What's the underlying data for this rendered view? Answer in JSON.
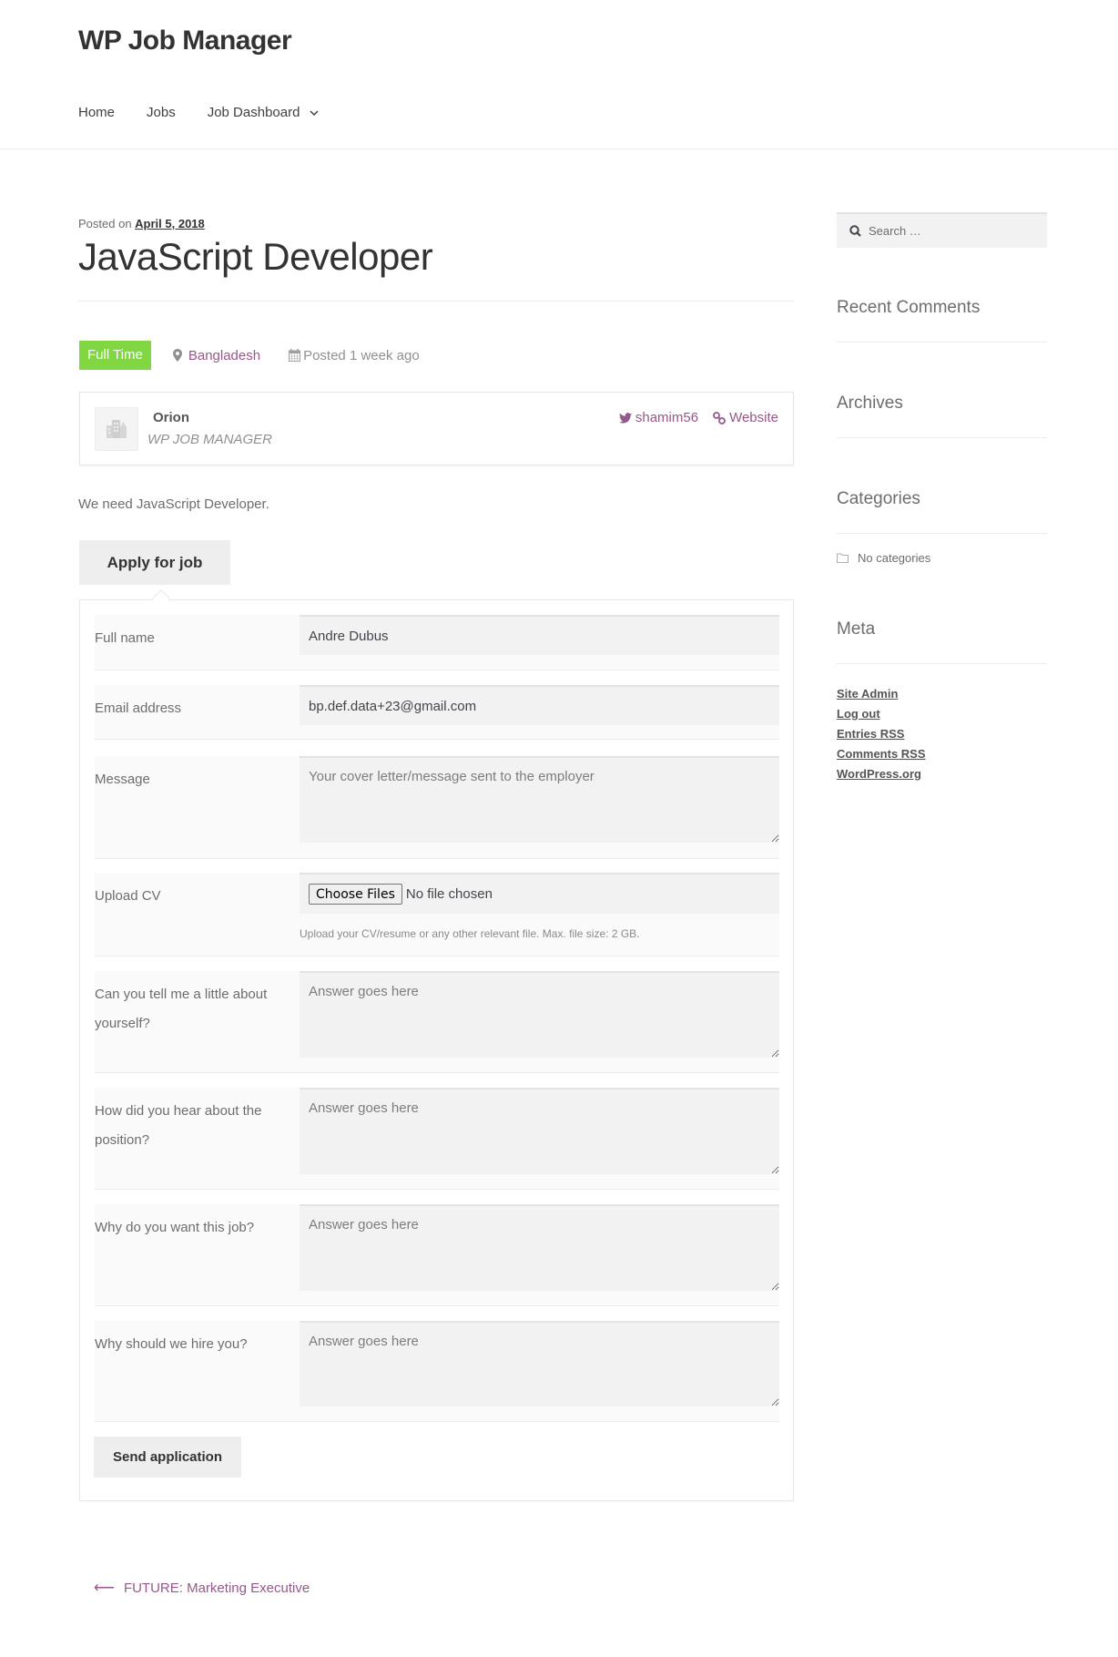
{
  "header": {
    "site_title": "WP Job Manager",
    "nav": [
      {
        "label": "Home"
      },
      {
        "label": "Jobs"
      },
      {
        "label": "Job Dashboard",
        "has_submenu": true
      }
    ]
  },
  "post": {
    "posted_on_prefix": "Posted on",
    "posted_on_date": "April 5, 2018",
    "title": "JavaScript Developer"
  },
  "job_meta": {
    "type_badge": "Full Time",
    "type_color": "#81d742",
    "location": "Bangladesh",
    "posted": "Posted 1 week ago"
  },
  "company": {
    "name": "Orion",
    "tagline": "WP JOB MANAGER",
    "twitter": "shamim56",
    "website_label": "Website"
  },
  "description": "We need JavaScript Developer.",
  "apply_button": "Apply for job",
  "form": {
    "fields": [
      {
        "label": "Full name",
        "type": "text",
        "value": "Andre Dubus",
        "placeholder": ""
      },
      {
        "label": "Email address",
        "type": "email",
        "value": "bp.def.data+23@gmail.com",
        "placeholder": ""
      },
      {
        "label": "Message",
        "type": "textarea",
        "value": "",
        "placeholder": "Your cover letter/message sent to the employer"
      },
      {
        "label": "Upload CV",
        "type": "file",
        "button": "Choose Files",
        "status": "No file chosen",
        "hint": "Upload your CV/resume or any other relevant file. Max. file size: 2 GB."
      },
      {
        "label": "Can you tell me a little about yourself?",
        "type": "textarea",
        "value": "",
        "placeholder": "Answer goes here"
      },
      {
        "label": "How did you hear about the position?",
        "type": "textarea",
        "value": "",
        "placeholder": "Answer goes here"
      },
      {
        "label": "Why do you want this job?",
        "type": "textarea",
        "value": "",
        "placeholder": "Answer goes here"
      },
      {
        "label": "Why should we hire you?",
        "type": "textarea",
        "value": "",
        "placeholder": "Answer goes here"
      }
    ],
    "submit": "Send application"
  },
  "post_nav": {
    "previous": "FUTURE: Marketing Executive"
  },
  "sidebar": {
    "search_placeholder": "Search …",
    "widgets": [
      {
        "title": "Recent Comments"
      },
      {
        "title": "Archives"
      },
      {
        "title": "Categories",
        "empty_text": "No categories"
      },
      {
        "title": "Meta",
        "links": [
          {
            "label": "Site Admin"
          },
          {
            "label": "Log out"
          },
          {
            "label_prefix": "Entries ",
            "abbr": "RSS"
          },
          {
            "label_prefix": "Comments ",
            "abbr": "RSS"
          },
          {
            "label": "WordPress.org"
          }
        ]
      }
    ]
  },
  "colors": {
    "accent_link": "#96588a",
    "badge_green": "#81d742",
    "heading": "#333333",
    "body_text": "#6d6d6d"
  }
}
